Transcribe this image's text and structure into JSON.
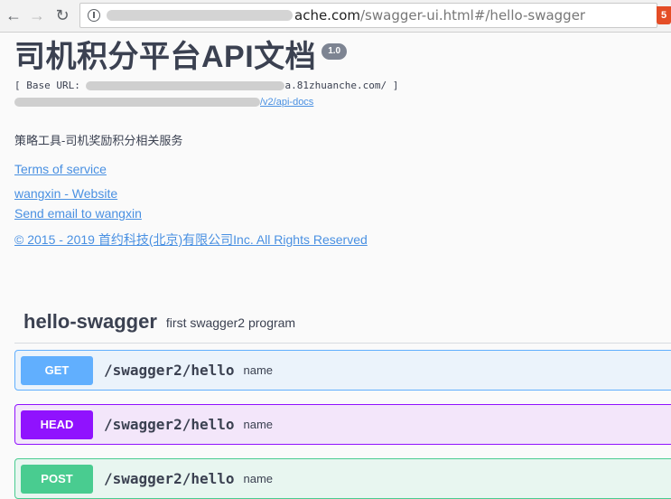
{
  "browser": {
    "url_host": "ache.com",
    "url_path": "/swagger-ui.html#/hello-swagger"
  },
  "info": {
    "title": "司机积分平台API文档",
    "version": "1.0",
    "base_url_prefix": "[ Base URL: ",
    "base_url_visible": "a.81zhuanche.com/ ]",
    "api_docs_link_visible": "/v2/api-docs",
    "description": "策略工具-司机奖励积分相关服务",
    "terms_link": "Terms of service",
    "contact_website_link": "wangxin - Website",
    "contact_email_link": "Send email to wangxin",
    "license_link": "© 2015 - 2019 首约科技(北京)有限公司Inc. All Rights Reserved"
  },
  "tag": {
    "name": "hello-swagger",
    "description": "first swagger2 program"
  },
  "operations": [
    {
      "method": "GET",
      "path": "/swagger2/hello",
      "summary": "name",
      "color": "#61affe"
    },
    {
      "method": "HEAD",
      "path": "/swagger2/hello",
      "summary": "name",
      "color": "#9012fe"
    },
    {
      "method": "POST",
      "path": "/swagger2/hello",
      "summary": "name",
      "color": "#49cc90"
    }
  ]
}
